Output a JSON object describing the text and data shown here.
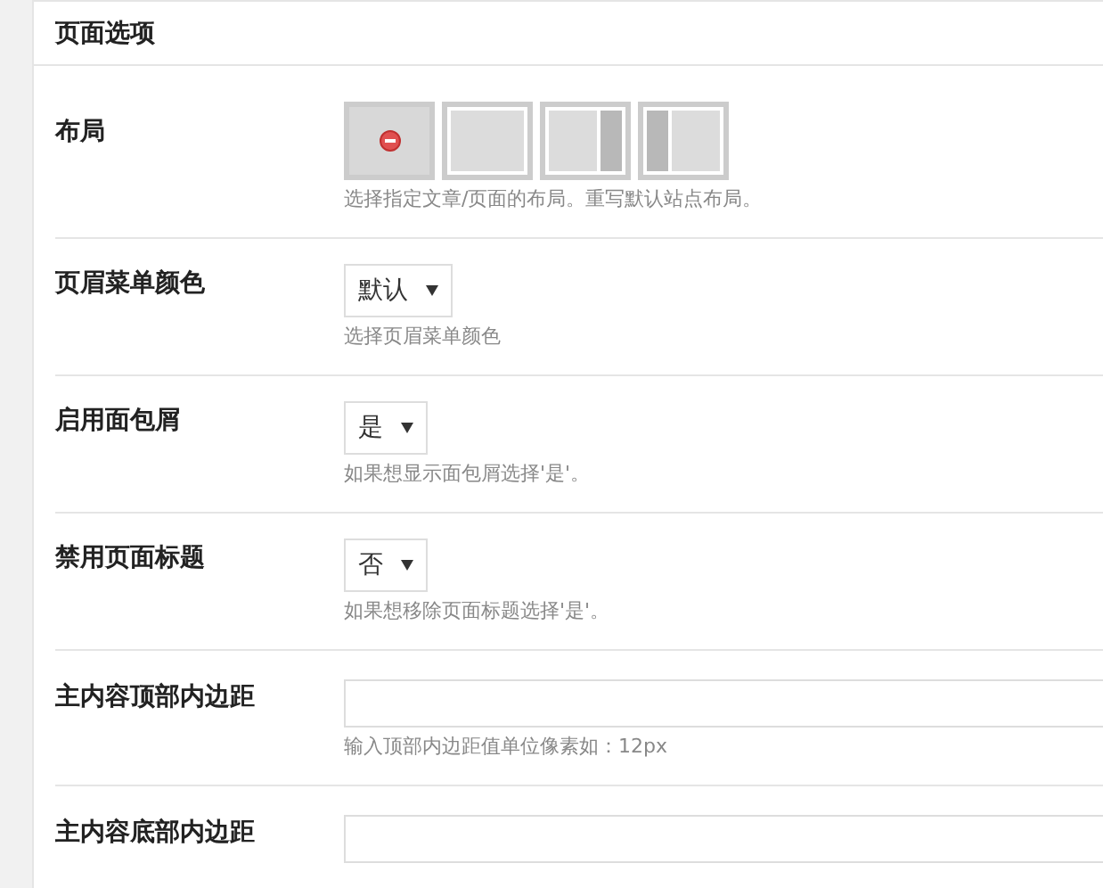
{
  "panel": {
    "title": "页面选项"
  },
  "rows": [
    {
      "kind": "layout",
      "label": "布局",
      "options": [
        {
          "kind": "none"
        },
        {
          "kind": "full"
        },
        {
          "kind": "right-sidebar"
        },
        {
          "kind": "left-sidebar"
        }
      ],
      "hint": "选择指定文章/页面的布局。重写默认站点布局。"
    },
    {
      "kind": "select",
      "label": "页眉菜单颜色",
      "value": "默认",
      "hint": "选择页眉菜单颜色"
    },
    {
      "kind": "select",
      "label": "启用面包屑",
      "value": "是",
      "hint": "如果想显示面包屑选择'是'。"
    },
    {
      "kind": "select",
      "label": "禁用页面标题",
      "value": "否",
      "hint": "如果想移除页面标题选择'是'。"
    },
    {
      "kind": "text",
      "label": "主内容顶部内边距",
      "hint": "输入顶部内边距值单位像素如：12px"
    },
    {
      "kind": "text",
      "label": "主内容底部内边距"
    }
  ]
}
